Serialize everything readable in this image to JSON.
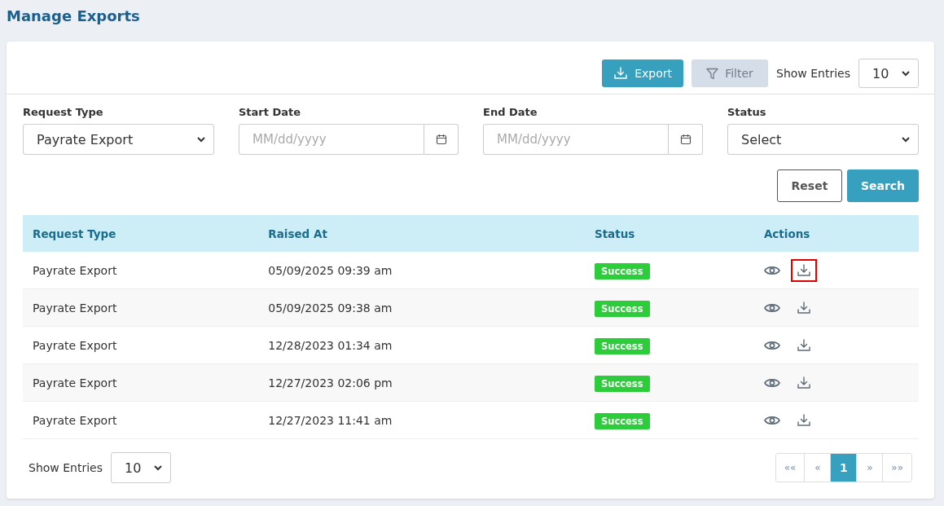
{
  "page_title": "Manage Exports",
  "toolbar": {
    "export_button": "Export",
    "filter_button": "Filter",
    "show_entries_label": "Show Entries",
    "show_entries_value": "10"
  },
  "filters": [
    {
      "kind": "select",
      "label": "Request Type",
      "value": "Payrate Export"
    },
    {
      "kind": "date",
      "label": "Start Date",
      "placeholder": "MM/dd/yyyy"
    },
    {
      "kind": "date",
      "label": "End Date",
      "placeholder": "MM/dd/yyyy"
    },
    {
      "kind": "select",
      "label": "Status",
      "value": "Select"
    }
  ],
  "reset_button": "Reset",
  "search_button": "Search",
  "table": {
    "columns": [
      "Request Type",
      "Raised At",
      "Status",
      "Actions"
    ],
    "rows": [
      {
        "request_type": "Payrate Export",
        "raised_at": "05/09/2025 09:39 am",
        "status": "Success",
        "highlighted": true
      },
      {
        "request_type": "Payrate Export",
        "raised_at": "05/09/2025 09:38 am",
        "status": "Success",
        "highlighted": false
      },
      {
        "request_type": "Payrate Export",
        "raised_at": "12/28/2023 01:34 am",
        "status": "Success",
        "highlighted": false
      },
      {
        "request_type": "Payrate Export",
        "raised_at": "12/27/2023 02:06 pm",
        "status": "Success",
        "highlighted": false
      },
      {
        "request_type": "Payrate Export",
        "raised_at": "12/27/2023 11:41 am",
        "status": "Success",
        "highlighted": false
      }
    ]
  },
  "footer": {
    "show_entries_label": "Show Entries",
    "show_entries_value": "10"
  },
  "pagination": [
    {
      "label": "««",
      "selected": false
    },
    {
      "label": "«",
      "selected": false
    },
    {
      "label": "1",
      "selected": true
    },
    {
      "label": "»",
      "selected": false
    },
    {
      "label": "»»",
      "selected": false
    }
  ]
}
